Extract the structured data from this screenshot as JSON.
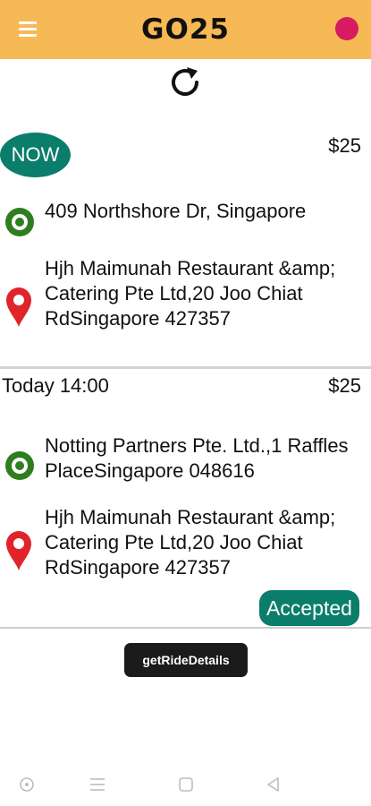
{
  "app": {
    "title": "GO25"
  },
  "rides": [
    {
      "time": "NOW",
      "price": "$25",
      "pickup": "409 Northshore Dr, Singapore",
      "destination": "Hjh Maimunah Restaurant &amp; Catering Pte Ltd,20 Joo Chiat RdSingapore 427357"
    },
    {
      "time": "Today 14:00",
      "price": "$25",
      "pickup": "Notting Partners Pte. Ltd.,1 Raffles PlaceSingapore 048616",
      "destination": "Hjh Maimunah Restaurant &amp; Catering Pte Ltd,20 Joo Chiat RdSingapore 427357",
      "status": "Accepted"
    }
  ],
  "toast": {
    "message": "getRideDetails"
  },
  "colors": {
    "header": "#f7b955",
    "accent_teal": "#0a7d6b",
    "status_dot": "#d81b60",
    "pickup_green": "#2e7d1f",
    "pin_red": "#e0242c"
  }
}
